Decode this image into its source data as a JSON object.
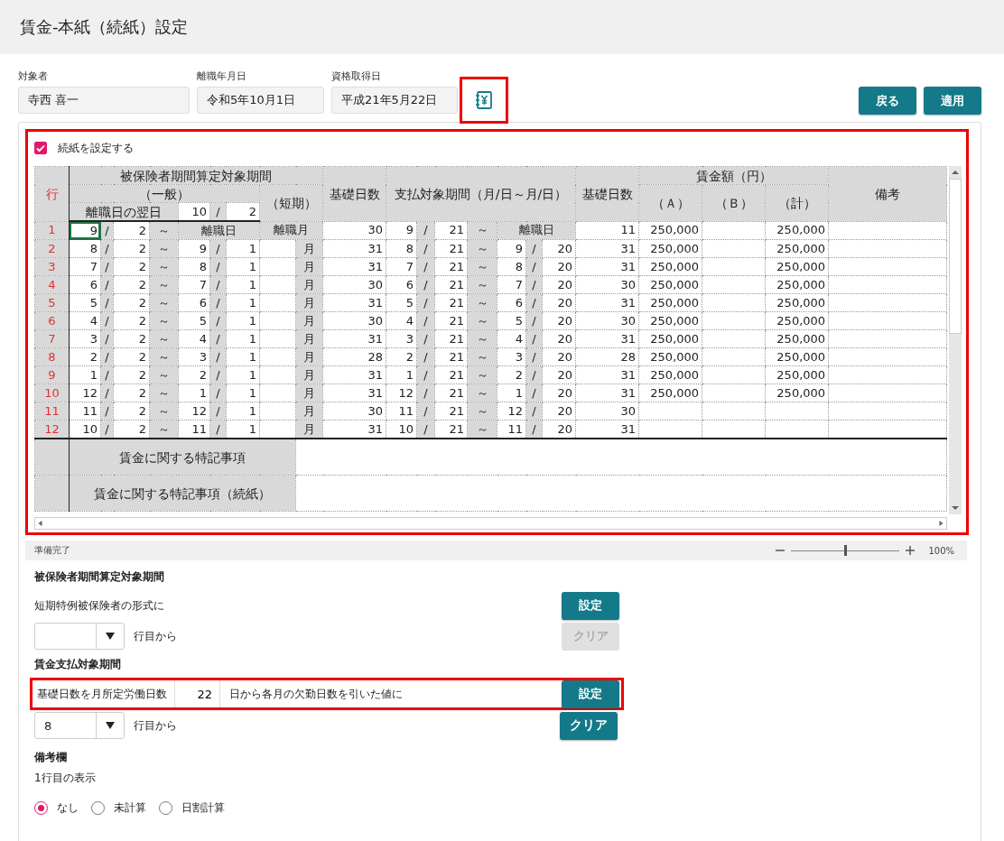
{
  "title": "賃金-本紙（続紙）設定",
  "fields": [
    {
      "label": "対象者",
      "value": "寺西 喜一"
    },
    {
      "label": "離職年月日",
      "value": "令和5年10月1日"
    },
    {
      "label": "資格取得日",
      "value": "平成21年5月22日"
    }
  ],
  "buttons": [
    {
      "label": "戻る"
    },
    {
      "label": "適用"
    }
  ],
  "continuation": {
    "label": "続紙を設定する",
    "checked": true
  },
  "header": {
    "row_no": "行",
    "insured_period": "被保険者期間算定対象期間",
    "general": "（一般）",
    "short": "（短期）",
    "base_days": "基礎日数",
    "pay_period": "支払対象期間（月/日～月/日）",
    "pay_base_days": "基礎日数",
    "wage": "賃金額（円）",
    "a": "（Ａ）",
    "b": "（Ｂ）",
    "total": "（計）",
    "remarks": "備考",
    "next_day_label": "離職日の翌日",
    "next_day": [
      "10",
      "/",
      "2"
    ]
  },
  "rows": [
    {
      "kind": "separation",
      "selected": true,
      "no": "1",
      "from": [
        "9",
        "/",
        "2"
      ],
      "sep": "～",
      "to": "離職日",
      "short": "離職月",
      "days": "30",
      "pay_from": [
        "9",
        "/",
        "21"
      ],
      "pay_sep": "～",
      "pay_to": "離職日",
      "pay_days": "11",
      "a": "250,000",
      "total": "250,000"
    },
    {
      "kind": "regular",
      "selected": false,
      "no": "2",
      "from": [
        "8",
        "/",
        "2"
      ],
      "sep": "～",
      "to": [
        "9",
        "/",
        "1"
      ],
      "short_unit": "月",
      "days": "31",
      "pay_from": [
        "8",
        "/",
        "21"
      ],
      "pay_sep": "～",
      "pay_to": [
        "9",
        "/",
        "20"
      ],
      "pay_days": "31",
      "a": "250,000",
      "total": "250,000"
    },
    {
      "kind": "regular",
      "selected": false,
      "no": "3",
      "from": [
        "7",
        "/",
        "2"
      ],
      "sep": "～",
      "to": [
        "8",
        "/",
        "1"
      ],
      "short_unit": "月",
      "days": "31",
      "pay_from": [
        "7",
        "/",
        "21"
      ],
      "pay_sep": "～",
      "pay_to": [
        "8",
        "/",
        "20"
      ],
      "pay_days": "31",
      "a": "250,000",
      "total": "250,000"
    },
    {
      "kind": "regular",
      "selected": false,
      "no": "4",
      "from": [
        "6",
        "/",
        "2"
      ],
      "sep": "～",
      "to": [
        "7",
        "/",
        "1"
      ],
      "short_unit": "月",
      "days": "30",
      "pay_from": [
        "6",
        "/",
        "21"
      ],
      "pay_sep": "～",
      "pay_to": [
        "7",
        "/",
        "20"
      ],
      "pay_days": "30",
      "a": "250,000",
      "total": "250,000"
    },
    {
      "kind": "regular",
      "selected": false,
      "no": "5",
      "from": [
        "5",
        "/",
        "2"
      ],
      "sep": "～",
      "to": [
        "6",
        "/",
        "1"
      ],
      "short_unit": "月",
      "days": "31",
      "pay_from": [
        "5",
        "/",
        "21"
      ],
      "pay_sep": "～",
      "pay_to": [
        "6",
        "/",
        "20"
      ],
      "pay_days": "31",
      "a": "250,000",
      "total": "250,000"
    },
    {
      "kind": "regular",
      "selected": false,
      "no": "6",
      "from": [
        "4",
        "/",
        "2"
      ],
      "sep": "～",
      "to": [
        "5",
        "/",
        "1"
      ],
      "short_unit": "月",
      "days": "30",
      "pay_from": [
        "4",
        "/",
        "21"
      ],
      "pay_sep": "～",
      "pay_to": [
        "5",
        "/",
        "20"
      ],
      "pay_days": "30",
      "a": "250,000",
      "total": "250,000"
    },
    {
      "kind": "regular",
      "selected": false,
      "no": "7",
      "from": [
        "3",
        "/",
        "2"
      ],
      "sep": "～",
      "to": [
        "4",
        "/",
        "1"
      ],
      "short_unit": "月",
      "days": "31",
      "pay_from": [
        "3",
        "/",
        "21"
      ],
      "pay_sep": "～",
      "pay_to": [
        "4",
        "/",
        "20"
      ],
      "pay_days": "31",
      "a": "250,000",
      "total": "250,000"
    },
    {
      "kind": "regular",
      "selected": false,
      "no": "8",
      "from": [
        "2",
        "/",
        "2"
      ],
      "sep": "～",
      "to": [
        "3",
        "/",
        "1"
      ],
      "short_unit": "月",
      "days": "28",
      "pay_from": [
        "2",
        "/",
        "21"
      ],
      "pay_sep": "～",
      "pay_to": [
        "3",
        "/",
        "20"
      ],
      "pay_days": "28",
      "a": "250,000",
      "total": "250,000"
    },
    {
      "kind": "regular",
      "selected": false,
      "no": "9",
      "from": [
        "1",
        "/",
        "2"
      ],
      "sep": "～",
      "to": [
        "2",
        "/",
        "1"
      ],
      "short_unit": "月",
      "days": "31",
      "pay_from": [
        "1",
        "/",
        "21"
      ],
      "pay_sep": "～",
      "pay_to": [
        "2",
        "/",
        "20"
      ],
      "pay_days": "31",
      "a": "250,000",
      "total": "250,000"
    },
    {
      "kind": "regular",
      "selected": false,
      "no": "10",
      "from": [
        "12",
        "/",
        "2"
      ],
      "sep": "～",
      "to": [
        "1",
        "/",
        "1"
      ],
      "short_unit": "月",
      "days": "31",
      "pay_from": [
        "12",
        "/",
        "21"
      ],
      "pay_sep": "～",
      "pay_to": [
        "1",
        "/",
        "20"
      ],
      "pay_days": "31",
      "a": "250,000",
      "total": "250,000"
    },
    {
      "kind": "regular",
      "selected": false,
      "no": "11",
      "from": [
        "11",
        "/",
        "2"
      ],
      "sep": "～",
      "to": [
        "12",
        "/",
        "1"
      ],
      "short_unit": "月",
      "days": "30",
      "pay_from": [
        "11",
        "/",
        "21"
      ],
      "pay_sep": "～",
      "pay_to": [
        "12",
        "/",
        "20"
      ],
      "pay_days": "30"
    },
    {
      "kind": "regular",
      "selected": false,
      "no": "12",
      "from": [
        "10",
        "/",
        "2"
      ],
      "sep": "～",
      "to": [
        "11",
        "/",
        "1"
      ],
      "short_unit": "月",
      "days": "31",
      "pay_from": [
        "10",
        "/",
        "21"
      ],
      "pay_sep": "～",
      "pay_to": [
        "11",
        "/",
        "20"
      ],
      "pay_days": "31"
    }
  ],
  "notes": [
    {
      "label": "賃金に関する特記事項"
    },
    {
      "label": "賃金に関する特記事項（続紙）"
    }
  ],
  "status_bar": {
    "status": "準備完了",
    "zoom": {
      "level": 0.5,
      "reading": "100%"
    }
  },
  "insured_section": {
    "title": "被保険者期間算定対象期間",
    "text": "短期特例被保険者の形式に",
    "suffix": "行目から",
    "set_button": {
      "label": "設定",
      "disabled": false
    },
    "clear_button": {
      "label": "クリア",
      "disabled": true
    }
  },
  "pay_section": {
    "title": "賃金支払対象期間",
    "prefix": "基礎日数を月所定労働日数",
    "days": "22",
    "text": "日から各月の欠勤日数を引いた値に",
    "select": "8",
    "suffix": "行目から",
    "set_button": {
      "label": "設定",
      "disabled": false
    },
    "clear_button": {
      "label": "クリア",
      "disabled": false
    }
  },
  "remarks_section": {
    "title": "備考欄",
    "subtitle": "1行目の表示",
    "options": [
      {
        "label": "なし",
        "selected": true
      },
      {
        "label": "未計算",
        "selected": false
      },
      {
        "label": "日割計算",
        "selected": false
      }
    ]
  }
}
